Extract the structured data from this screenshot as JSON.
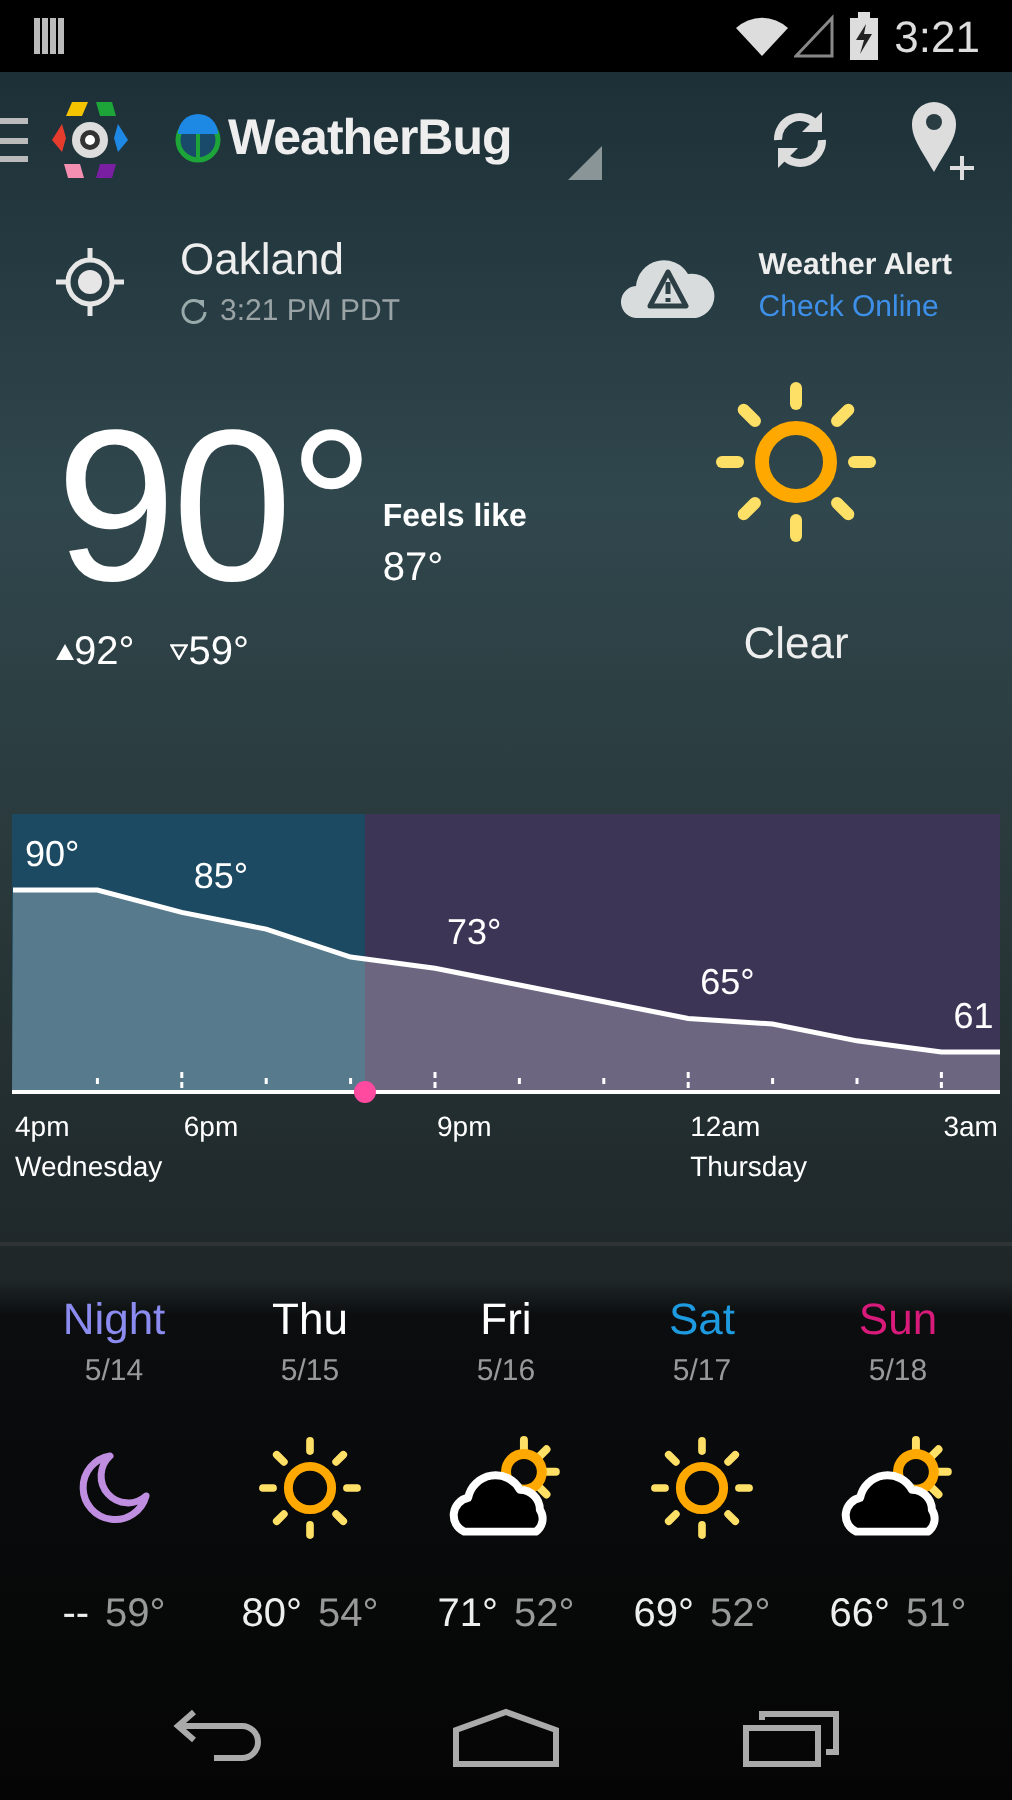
{
  "status_bar": {
    "time": "3:21"
  },
  "app_bar": {
    "brand": "WeatherBug"
  },
  "location": {
    "city": "Oakland",
    "updated": "3:21 PM PDT"
  },
  "alert": {
    "title": "Weather Alert",
    "link": "Check Online"
  },
  "current": {
    "temp": "90°",
    "feels_like_label": "Feels like",
    "feels_like": "87°",
    "high": "92°",
    "low": "59°",
    "condition": "Clear",
    "kind": "sunny"
  },
  "hourly": {
    "temperature_labels": [
      "90°",
      "85°",
      "73°",
      "65°",
      "61"
    ],
    "hour_labels": [
      "4pm",
      "6pm",
      "9pm",
      "12am",
      "3am"
    ],
    "day_labels": [
      "Wednesday",
      "Thursday"
    ]
  },
  "forecast": [
    {
      "day": "Night",
      "date": "5/14",
      "color": "#8c8cf0",
      "kind": "moon",
      "high": "--",
      "low": "59°"
    },
    {
      "day": "Thu",
      "date": "5/15",
      "color": "#ffffff",
      "kind": "sunny",
      "high": "80°",
      "low": "54°"
    },
    {
      "day": "Fri",
      "date": "5/16",
      "color": "#ffffff",
      "kind": "partly-cloudy",
      "high": "71°",
      "low": "52°"
    },
    {
      "day": "Sat",
      "date": "5/17",
      "color": "#1e9be0",
      "kind": "sunny",
      "high": "69°",
      "low": "52°"
    },
    {
      "day": "Sun",
      "date": "5/18",
      "color": "#d81b7a",
      "kind": "partly-cloudy",
      "high": "66°",
      "low": "51°"
    }
  ]
}
